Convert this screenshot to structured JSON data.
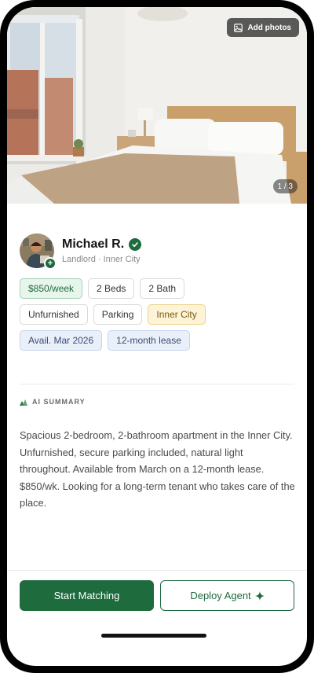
{
  "photo": {
    "add_photos_label": "Add photos",
    "counter": "1 / 3"
  },
  "profile": {
    "name": "Michael R.",
    "subtitle": "Landlord · Inner City",
    "badge": "+"
  },
  "tags": {
    "row1": [
      "$850/week",
      "2 Beds",
      "2 Bath"
    ],
    "row2": [
      "Unfurnished",
      "Parking",
      "Inner City"
    ],
    "row3": [
      "Avail. Mar 2026",
      "12-month lease"
    ]
  },
  "ai_summary": {
    "label": "AI SUMMARY",
    "text": "Spacious 2-bedroom, 2-bathroom apartment in the Inner City. Unfurnished, secure parking included, natural light throughout. Available from March on a 12-month lease. $850/wk. Looking for a long-term tenant who takes care of the place."
  },
  "actions": {
    "primary_label": "Start Matching",
    "secondary_label": "Deploy Agent",
    "secondary_icon": "sparkle-icon"
  },
  "colors": {
    "brand_green": "#1e6b3e",
    "price_tag_bg": "#e8f5ed",
    "location_tag_bg": "#fdf3d6",
    "date_tag_bg": "#eaf0f9"
  }
}
